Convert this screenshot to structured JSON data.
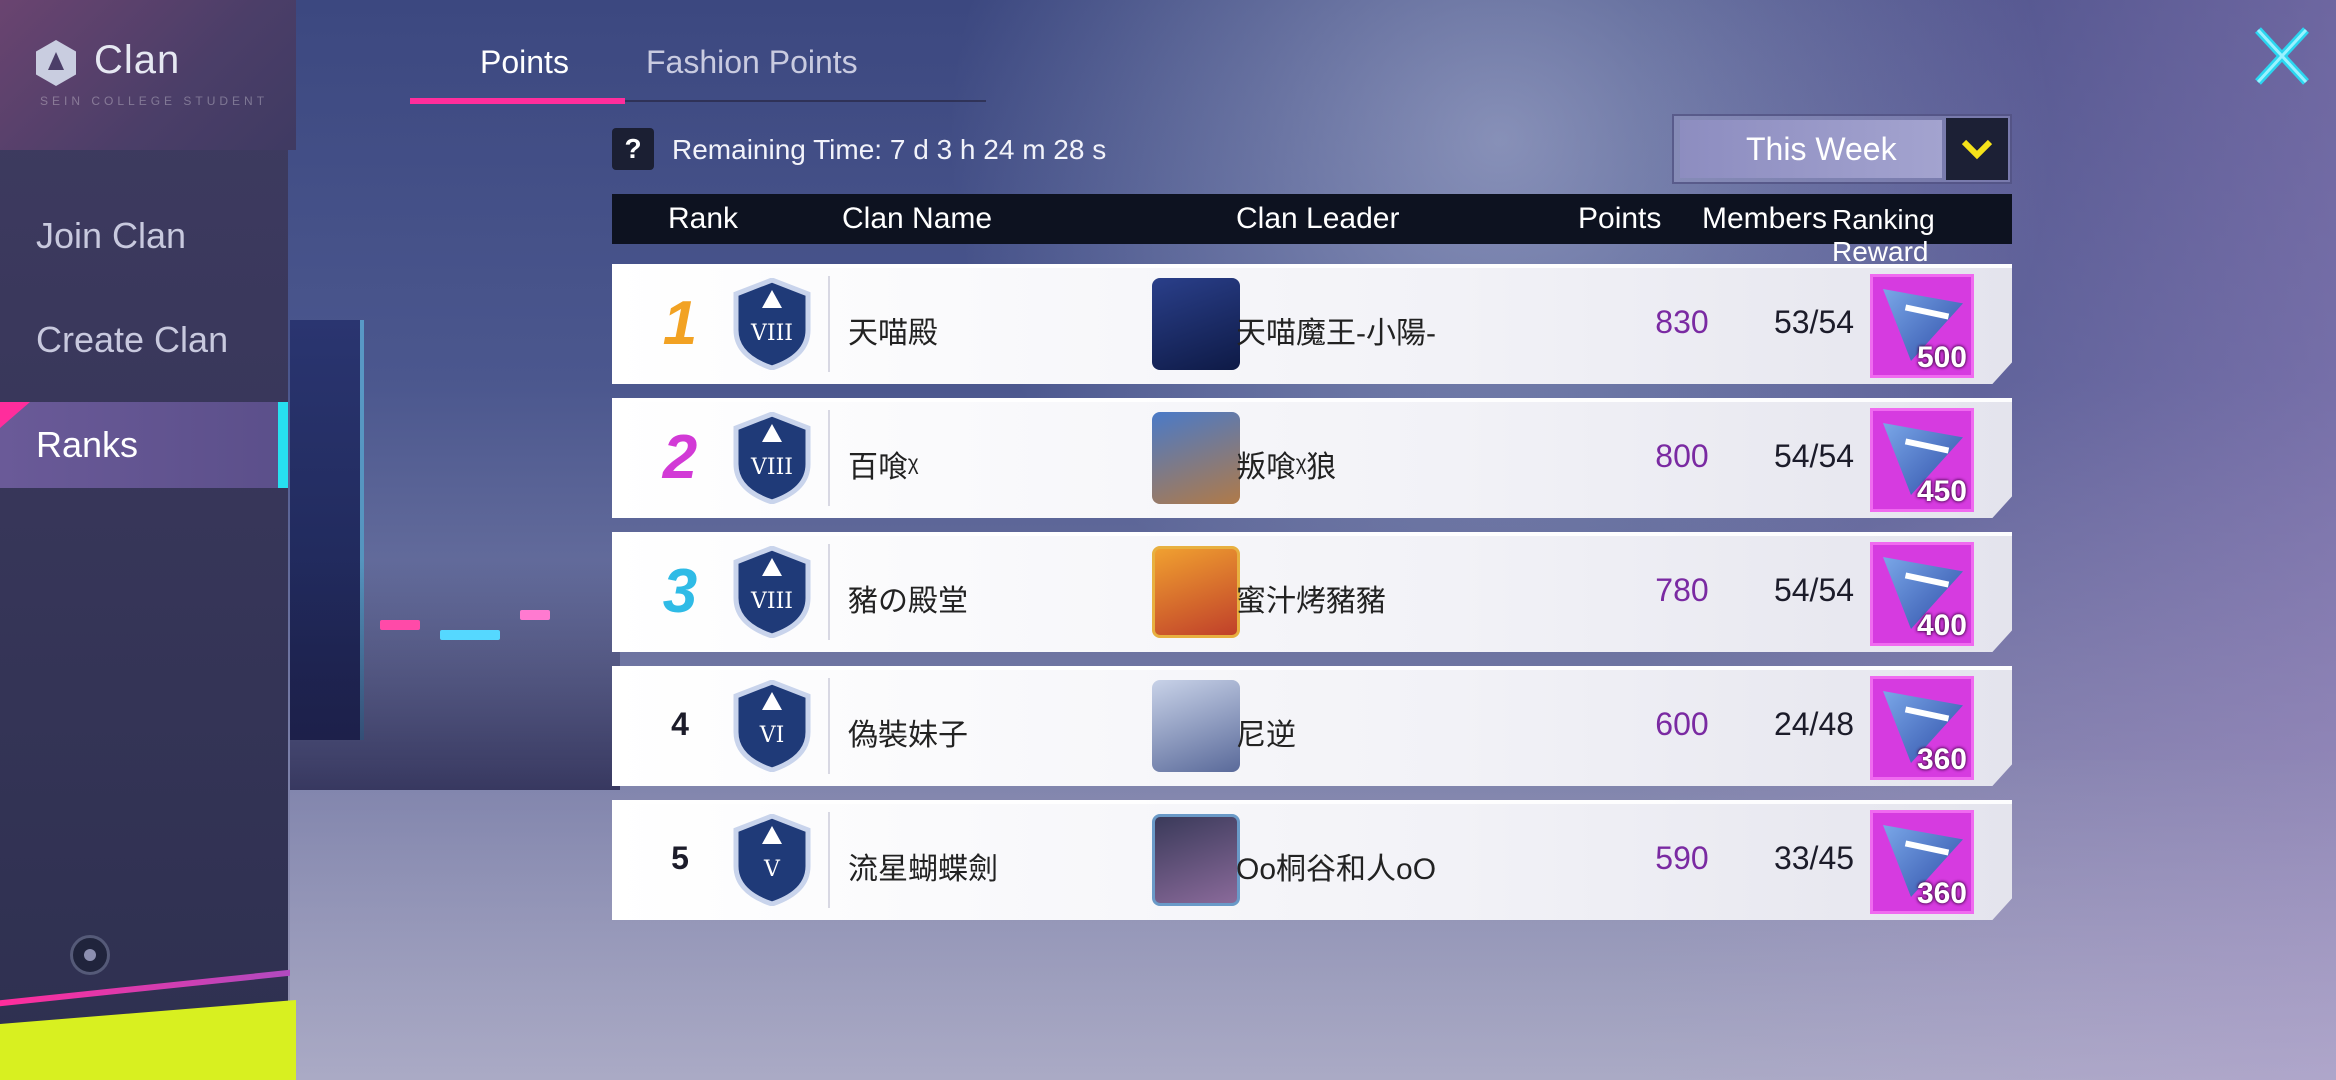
{
  "header": {
    "title": "Clan",
    "subtitle": "SEIN COLLEGE STUDENT"
  },
  "sidebar": {
    "items": [
      {
        "label": "Join Clan"
      },
      {
        "label": "Create Clan"
      },
      {
        "label": "Ranks"
      }
    ]
  },
  "tabs": [
    {
      "label": "Points",
      "active": true
    },
    {
      "label": "Fashion Points",
      "active": false
    }
  ],
  "remaining_time": "Remaining Time: 7 d 3 h 24 m 28 s",
  "help_label": "?",
  "period_select": {
    "value": "This Week"
  },
  "table": {
    "columns": [
      "Rank",
      "Clan Name",
      "Clan Leader",
      "Points",
      "Members",
      "Ranking Reward"
    ],
    "rows": [
      {
        "rank": "1",
        "badge": "VIII",
        "clan_name": "天喵殿",
        "leader": "天喵魔王-小陽-",
        "points": "830",
        "members": "53/54",
        "reward": "500"
      },
      {
        "rank": "2",
        "badge": "VIII",
        "clan_name": "百喰ᵡ",
        "leader": "叛喰ᵡ狼",
        "points": "800",
        "members": "54/54",
        "reward": "450"
      },
      {
        "rank": "3",
        "badge": "VIII",
        "clan_name": "豬の殿堂",
        "leader": "蜜汁烤豬豬",
        "points": "780",
        "members": "54/54",
        "reward": "400"
      },
      {
        "rank": "4",
        "badge": "VI",
        "clan_name": "偽裝妹子",
        "leader": "尼逆",
        "points": "600",
        "members": "24/48",
        "reward": "360"
      },
      {
        "rank": "5",
        "badge": "V",
        "clan_name": "流星蝴蝶劍",
        "leader": "Oo桐谷和人oO",
        "points": "590",
        "members": "33/45",
        "reward": "360"
      }
    ]
  },
  "colors": {
    "accent_pink": "#ff2d9c",
    "accent_cyan": "#27e0f0",
    "points_purple": "#7a2aa2",
    "rank1": "#f2a223",
    "rank2": "#d23ad6",
    "rank3": "#2fbbe6",
    "reward_bg": "#d63be0"
  },
  "icons": {
    "close": "close-x-icon",
    "dropdown": "chevron-down-icon",
    "reward": "crystal-gem-icon",
    "badge": "clan-shield-icon"
  }
}
